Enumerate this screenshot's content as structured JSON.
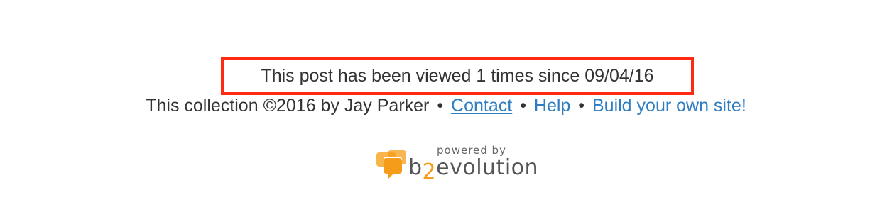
{
  "views": {
    "text": "This post has been viewed 1 times since 09/04/16",
    "highlight_color": "#ff2a12"
  },
  "collection": {
    "prefix": "This collection ©2016 by Jay Parker",
    "separator": "•",
    "links": [
      {
        "label": "Contact"
      },
      {
        "label": "Help"
      },
      {
        "label": "Build your own site!"
      }
    ],
    "link_color": "#2f7ec2"
  },
  "powered": {
    "powered_by": "powered by",
    "brand_b": "b",
    "brand_two": "2",
    "brand_rest": "evolution",
    "icon": "b2evolution-logo-icon",
    "accent_color": "#f59d1a"
  }
}
